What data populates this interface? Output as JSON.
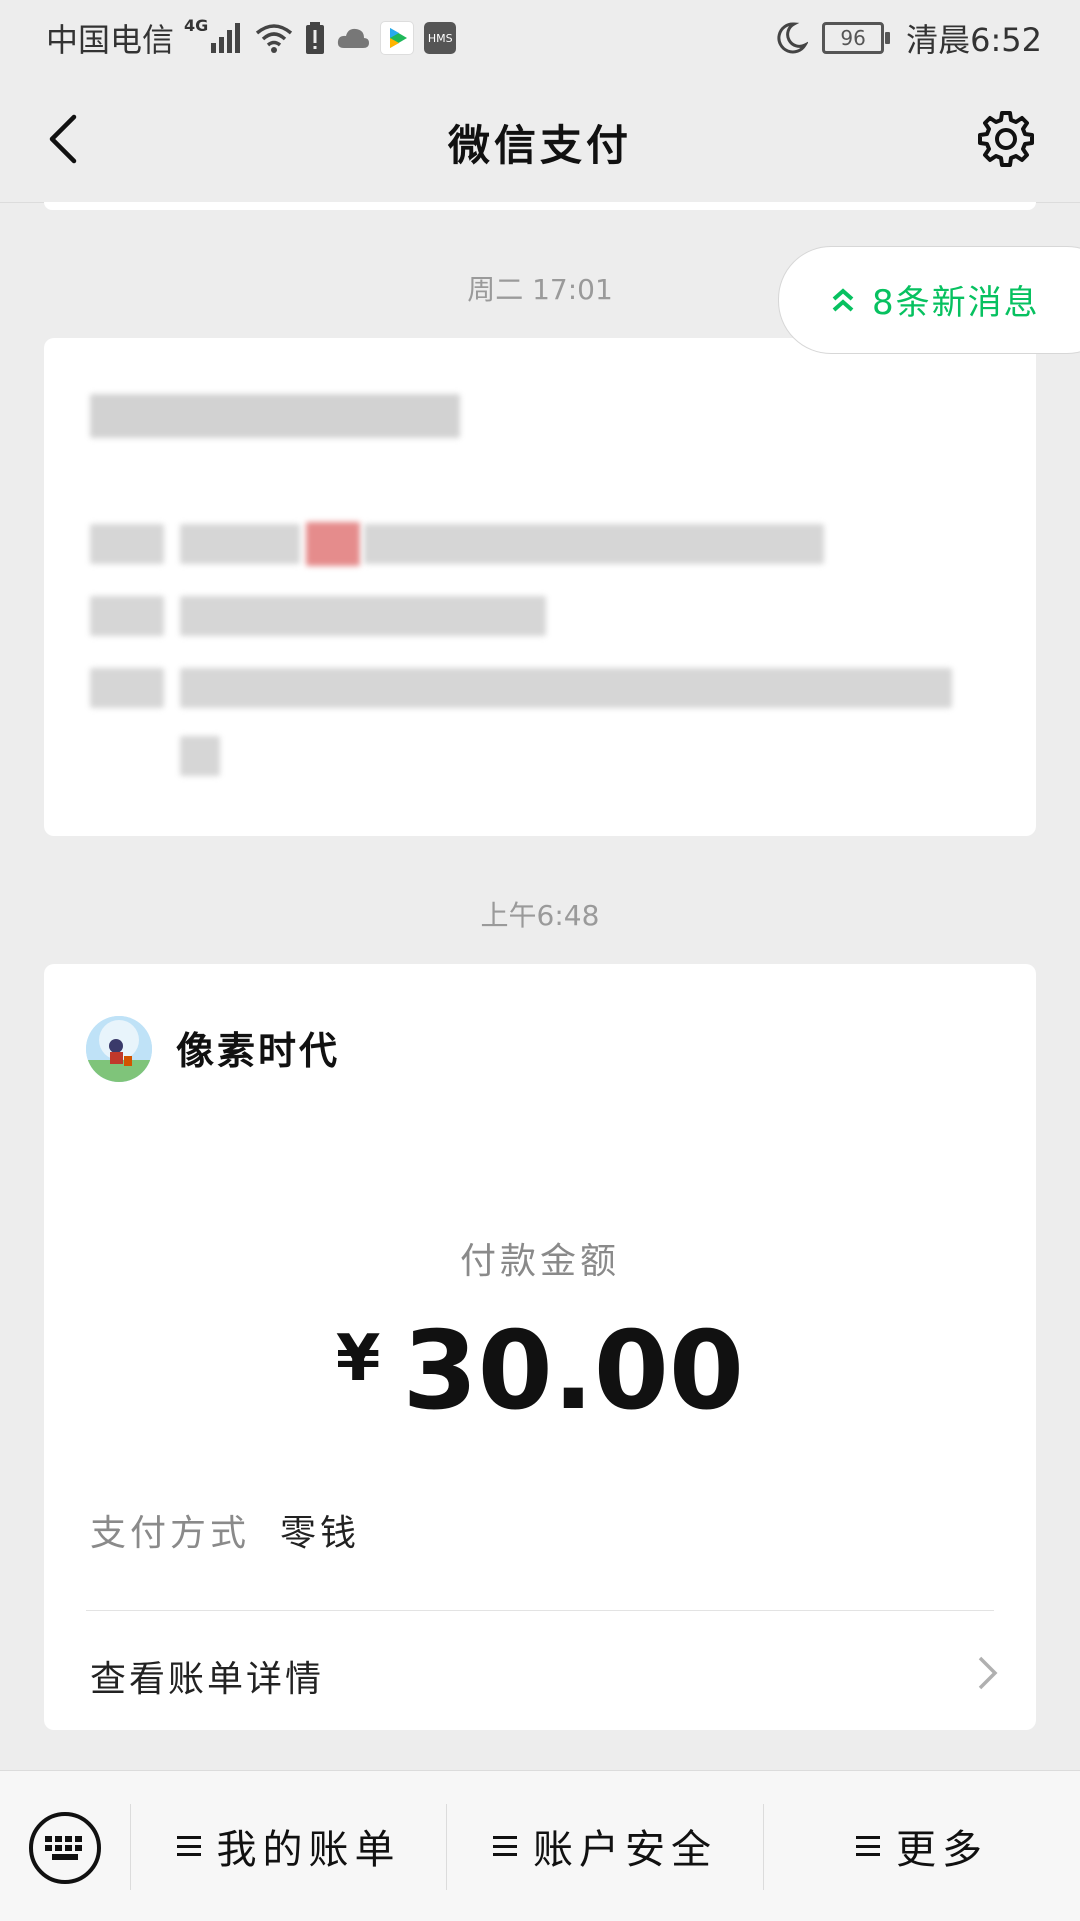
{
  "status_bar": {
    "carrier": "中国电信",
    "network": "4G",
    "battery": "96",
    "time": "清晨6:52",
    "app_badge": "HMS"
  },
  "nav": {
    "title": "微信支付"
  },
  "new_messages": {
    "label": "8条新消息"
  },
  "messages": [
    {
      "timestamp": "周二 17:01"
    },
    {
      "timestamp": "上午6:48"
    }
  ],
  "payment_card": {
    "merchant": "像素时代",
    "amount_label": "付款金额",
    "currency": "¥",
    "amount": "30.00",
    "method_label": "支付方式",
    "method_value": "零钱",
    "detail_link": "查看账单详情"
  },
  "bottom_menu": {
    "tabs": [
      {
        "label": "我的账单"
      },
      {
        "label": "账户安全"
      },
      {
        "label": "更多"
      }
    ]
  },
  "colors": {
    "background": "#ededed",
    "accent_green": "#07c160"
  }
}
